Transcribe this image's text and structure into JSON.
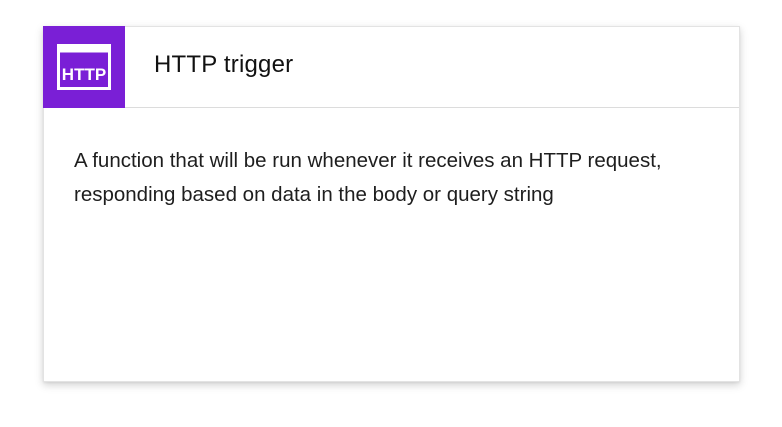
{
  "card": {
    "icon": "http-icon",
    "icon_label": "HTTP",
    "title": "HTTP trigger",
    "description": "A function that will be run whenever it receives an HTTP request, responding based on data in the body or query string",
    "accent_color": "#7a1fd6"
  }
}
